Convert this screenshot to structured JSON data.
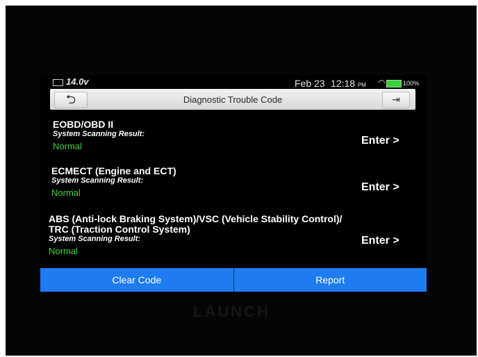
{
  "status": {
    "battery_voltage": "14.0v",
    "date": "Feb 23",
    "time": "12:18",
    "ampm": "PM",
    "battery_pct": "100%",
    "wifi_icon": "wifi-icon",
    "battery_icon": "battery-icon"
  },
  "header": {
    "title": "Diagnostic Trouble Code",
    "back_icon": "back-arrow-icon",
    "exit_icon": "exit-icon"
  },
  "systems": [
    {
      "name_line1": "EOBD/OBD II",
      "name_line2": "",
      "scan_label": "System Scanning Result:",
      "status": "Normal",
      "enter_label": "Enter >"
    },
    {
      "name_line1": "ECMECT (Engine and ECT)",
      "name_line2": "",
      "scan_label": "System Scanning Result:",
      "status": "Normal",
      "enter_label": "Enter >"
    },
    {
      "name_line1": "ABS (Anti-lock Braking System)/VSC (Vehicle Stability Control)/",
      "name_line2": "TRC (Traction Control System)",
      "scan_label": "System Scanning Result:",
      "status": "Normal",
      "enter_label": "Enter >"
    }
  ],
  "footer": {
    "clear_code": "Clear Code",
    "report": "Report"
  },
  "brand": "LAUNCH",
  "colors": {
    "accent": "#1e7cf0",
    "status_ok": "#3fd43f"
  }
}
